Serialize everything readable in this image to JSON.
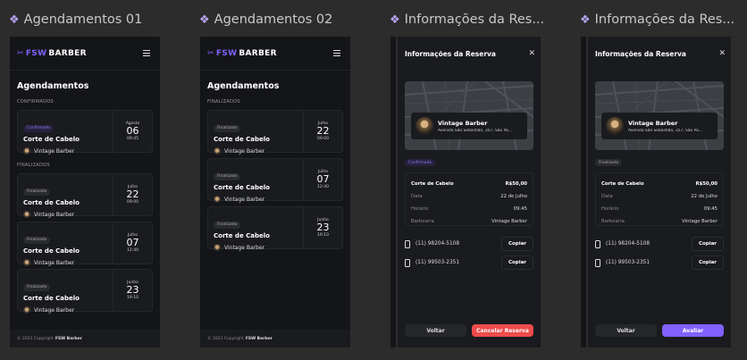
{
  "frames": {
    "f1": {
      "title": "Agendamentos 01"
    },
    "f2": {
      "title": "Agendamentos 02"
    },
    "f3": {
      "title": "Informações da Res..."
    },
    "f4": {
      "title": "Informações da Res..."
    }
  },
  "brand": {
    "logo_mark": "FSW",
    "logo_text": "BARBER"
  },
  "list": {
    "page_title": "Agendamentos",
    "section_confirmed": "CONFIRMADOS",
    "section_finished": "FINALIZADOS",
    "footer_prefix": "© 2023 Copyright",
    "footer_brand": "FSW Barber"
  },
  "bookings": [
    {
      "status": "Confirmado",
      "service": "Corte de Cabelo",
      "shop": "Vintage Barber",
      "month": "Agosto",
      "day": "06",
      "time": "09:45"
    },
    {
      "status": "Finalizado",
      "service": "Corte de Cabelo",
      "shop": "Vintage Barber",
      "month": "Julho",
      "day": "22",
      "time": "09:00"
    },
    {
      "status": "Finalizado",
      "service": "Corte de Cabelo",
      "shop": "Vintage Barber",
      "month": "Julho",
      "day": "07",
      "time": "12:40"
    },
    {
      "status": "Finalizado",
      "service": "Corte de Cabelo",
      "shop": "Vintage Barber",
      "month": "Junho",
      "day": "23",
      "time": "19:10"
    }
  ],
  "details": {
    "panel_title": "Informações da Reserva",
    "shop_name": "Vintage Barber",
    "shop_address": "Avenida São Sebastião, 357, São Pa...",
    "service": "Corte de Cabelo",
    "price": "R$50,00",
    "rows": [
      {
        "label": "Data",
        "value": "22 de Julho"
      },
      {
        "label": "Horário",
        "value": "09:45"
      },
      {
        "label": "Barbearia",
        "value": "Vintage Barber"
      }
    ],
    "phones": [
      "(11) 98204-5108",
      "(11) 99503-2351"
    ],
    "copy_label": "Copiar",
    "back_label": "Voltar"
  },
  "modal_a": {
    "status": "Confirmado",
    "action_label": "Cancelar Reserva"
  },
  "modal_b": {
    "status": "Finalizado",
    "action_label": "Avaliar"
  },
  "colors": {
    "accent": "#8161ff",
    "danger": "#ee4b4b",
    "background": "#141518",
    "canvas": "#2c2c2c"
  }
}
